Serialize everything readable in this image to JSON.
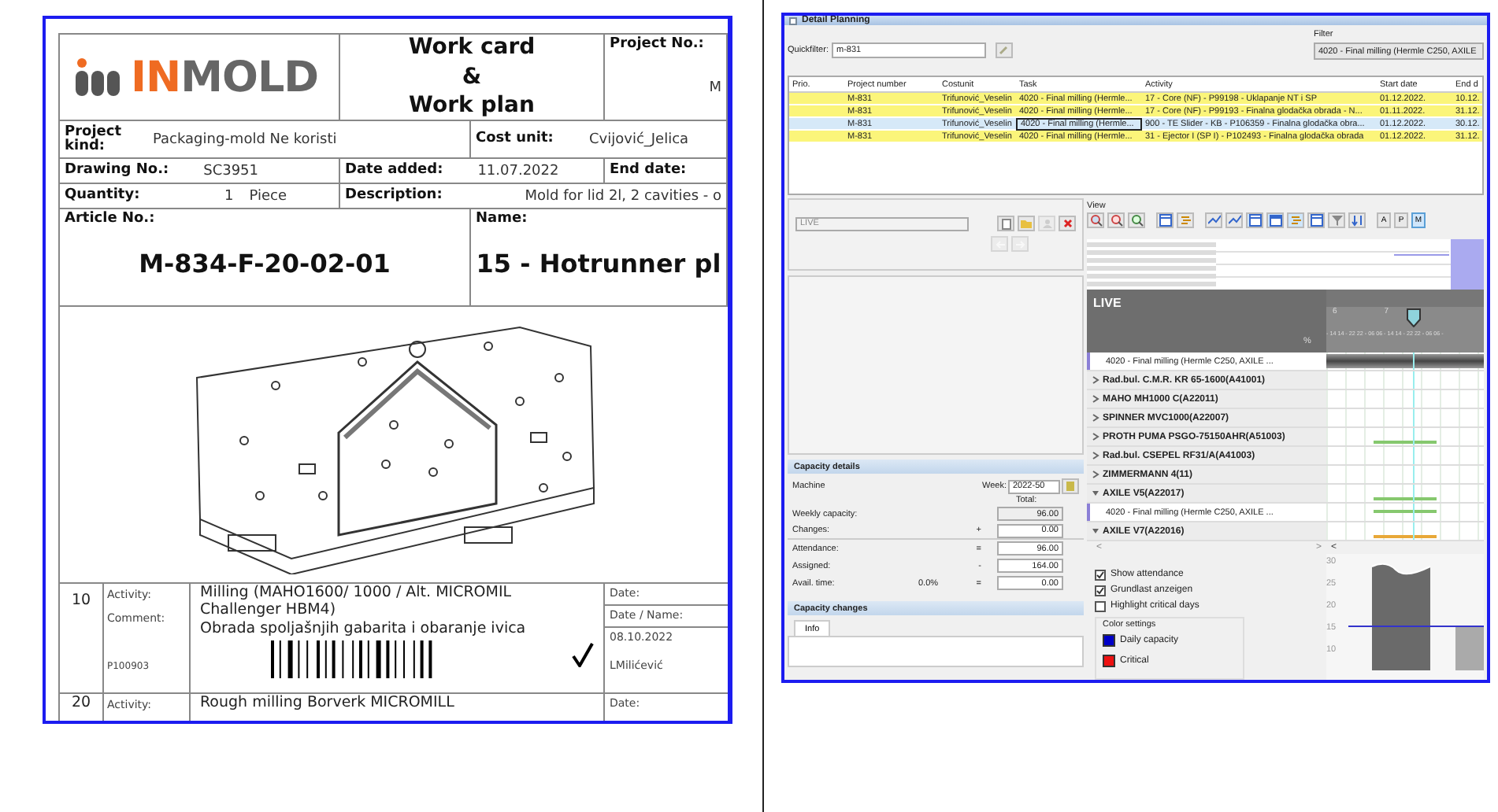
{
  "work_card": {
    "logo": {
      "accent": "IN",
      "rest": "MOLD"
    },
    "title_lines": [
      "Work card",
      "&",
      "Work plan"
    ],
    "project_no": {
      "label": "Project No.:",
      "value": "M"
    },
    "info_rows": [
      [
        {
          "label": "Project kind:",
          "value": "Packaging-mold Ne koristi"
        },
        {
          "label": "Cost unit:",
          "value": "Cvijović_Jelica"
        }
      ],
      [
        {
          "label": "Drawing No.:",
          "value": "SC3951"
        },
        {
          "label": "Date added:",
          "value": "11.07.2022"
        },
        {
          "label": "End date:"
        }
      ],
      [
        {
          "label": "Quantity:",
          "value": "1",
          "unit": "Piece"
        },
        {
          "label": "Description:",
          "value": "Mold for lid 2l, 2 cavities - o"
        }
      ],
      [
        {
          "label": "Article No.:",
          "big": "M-834-F-20-02-01"
        },
        {
          "label": "Name:",
          "big": "15 - Hotrunner pl"
        }
      ]
    ],
    "operations": [
      {
        "number": "10",
        "activity_label": "Activity:",
        "activity": "Milling (MAHO1600/ 1000 / Alt. MICROMIL Challenger HBM4)",
        "comment_label": "Comment:",
        "comment": "Obrada spoljašnjih gabarita i obaranje ivica",
        "code": "P100903",
        "done": true,
        "date_label": "Date:",
        "name_label": "Date / Name:",
        "date": "08.10.2022",
        "name": "LMilićević"
      },
      {
        "number": "20",
        "activity_label": "Activity:",
        "activity": "Rough milling Borverk MICROMILL",
        "date_label": "Date:"
      }
    ]
  },
  "planning": {
    "title": "Detail Planning",
    "quickfilter": {
      "label": "Quickfilter:",
      "value": "m-831"
    },
    "filter": {
      "label": "Filter",
      "value": "4020 - Final milling (Hermle C250, AXILE"
    },
    "table": {
      "columns": [
        "Prio.",
        "Project number",
        "Costunit",
        "Task",
        "Activity",
        "Start date",
        "End d"
      ],
      "rows": [
        {
          "project": "M-831",
          "costunit": "Trifunović_Veselin",
          "task": "4020 - Final milling (Hermle...",
          "activity": "17 - Core (NF) - P99198 - Uklapanje NT i SP",
          "start": "01.12.2022.",
          "end": "10.12.",
          "selected": false
        },
        {
          "project": "M-831",
          "costunit": "Trifunović_Veselin",
          "task": "4020 - Final milling (Hermle...",
          "activity": "17 - Core (NF) - P99193 - Finalna glodačka obrada - N...",
          "start": "01.11.2022.",
          "end": "31.12.",
          "selected": false
        },
        {
          "project": "M-831",
          "costunit": "Trifunović_Veselin",
          "task": "4020 - Final milling (Hermle...",
          "activity": "900 - TE Slider - KB - P106359 - Finalna glodačka obra...",
          "start": "01.12.2022.",
          "end": "30.12.",
          "selected": true
        },
        {
          "project": "M-831",
          "costunit": "Trifunović_Veselin",
          "task": "4020 - Final milling (Hermle...",
          "activity": "31 - Ejector I (SP I) - P102493 - Finalna glodačka obrada",
          "start": "01.12.2022.",
          "end": "31.12.",
          "selected": false
        }
      ]
    },
    "scenario": {
      "value": "LIVE",
      "disabled": true
    },
    "capacity_details": {
      "title": "Capacity details",
      "machine_label": "Machine",
      "week_label": "Week:",
      "week": "2022-50",
      "total_label": "Total:",
      "rows": [
        {
          "label": "Weekly capacity:",
          "value": "96.00"
        },
        {
          "label": "Changes:",
          "op": "+",
          "value": "0.00"
        },
        {
          "label": "Attendance:",
          "op": "=",
          "value": "96.00"
        },
        {
          "label": "Assigned:",
          "op": "-",
          "value": "164.00"
        },
        {
          "label": "Avail. time:",
          "percent": "0.0%",
          "op": "=",
          "value": "0.00"
        }
      ]
    },
    "capacity_changes": {
      "title": "Capacity changes",
      "tabs": [
        {
          "label": "Info",
          "selected": true
        }
      ]
    },
    "view": {
      "label": "View",
      "modes": [
        {
          "label": "A",
          "selected": false
        },
        {
          "label": "P",
          "selected": false
        },
        {
          "label": "M",
          "selected": true
        }
      ]
    },
    "gantt": {
      "title": "LIVE",
      "percent_label": "%",
      "days": [
        "6",
        "7"
      ],
      "scale": "- 14 14 - 22 22 - 06 06 - 14 14 - 22 22 - 06 06 -",
      "rows": [
        {
          "kind": "task",
          "label": "4020 - Final milling (Hermle C250, AXILE ..."
        },
        {
          "kind": "group",
          "label": "Rad.bul. C.M.R. KR 65-1600(A41001)",
          "expanded": false
        },
        {
          "kind": "group",
          "label": "MAHO MH1000 C(A22011)",
          "expanded": false
        },
        {
          "kind": "group",
          "label": "SPINNER MVC1000(A22007)",
          "expanded": false
        },
        {
          "kind": "group",
          "label": "PROTH PUMA PSGO-75150AHR(A51003)",
          "expanded": false,
          "color": "#86c86e"
        },
        {
          "kind": "group",
          "label": "Rad.bul. CSEPEL RF31/A(A41003)",
          "expanded": false
        },
        {
          "kind": "group",
          "label": "ZIMMERMANN 4(11)",
          "expanded": false
        },
        {
          "kind": "group",
          "label": "AXILE V5(A22017)",
          "expanded": true,
          "color": "#86c86e"
        },
        {
          "kind": "task",
          "label": "4020 - Final milling (Hermle C250, AXILE ...",
          "color": "#86c86e"
        },
        {
          "kind": "group",
          "label": "AXILE V7(A22016)",
          "expanded": true,
          "color": "#e8a838"
        }
      ],
      "scroll_left": "<",
      "scroll_right": ">",
      "chart_scroll": "<"
    },
    "options": [
      {
        "label": "Show attendance",
        "checked": true
      },
      {
        "label": "Grundlast anzeigen",
        "checked": true
      },
      {
        "label": "Highlight critical days",
        "checked": false
      }
    ],
    "color_settings": {
      "title": "Color settings",
      "items": [
        {
          "label": "Daily capacity",
          "color": "#0000c8"
        },
        {
          "label": "Critical",
          "color": "#ee1111"
        }
      ]
    },
    "capacity_chart": {
      "ticks": [
        "30",
        "25",
        "20",
        "15",
        "10"
      ]
    }
  }
}
